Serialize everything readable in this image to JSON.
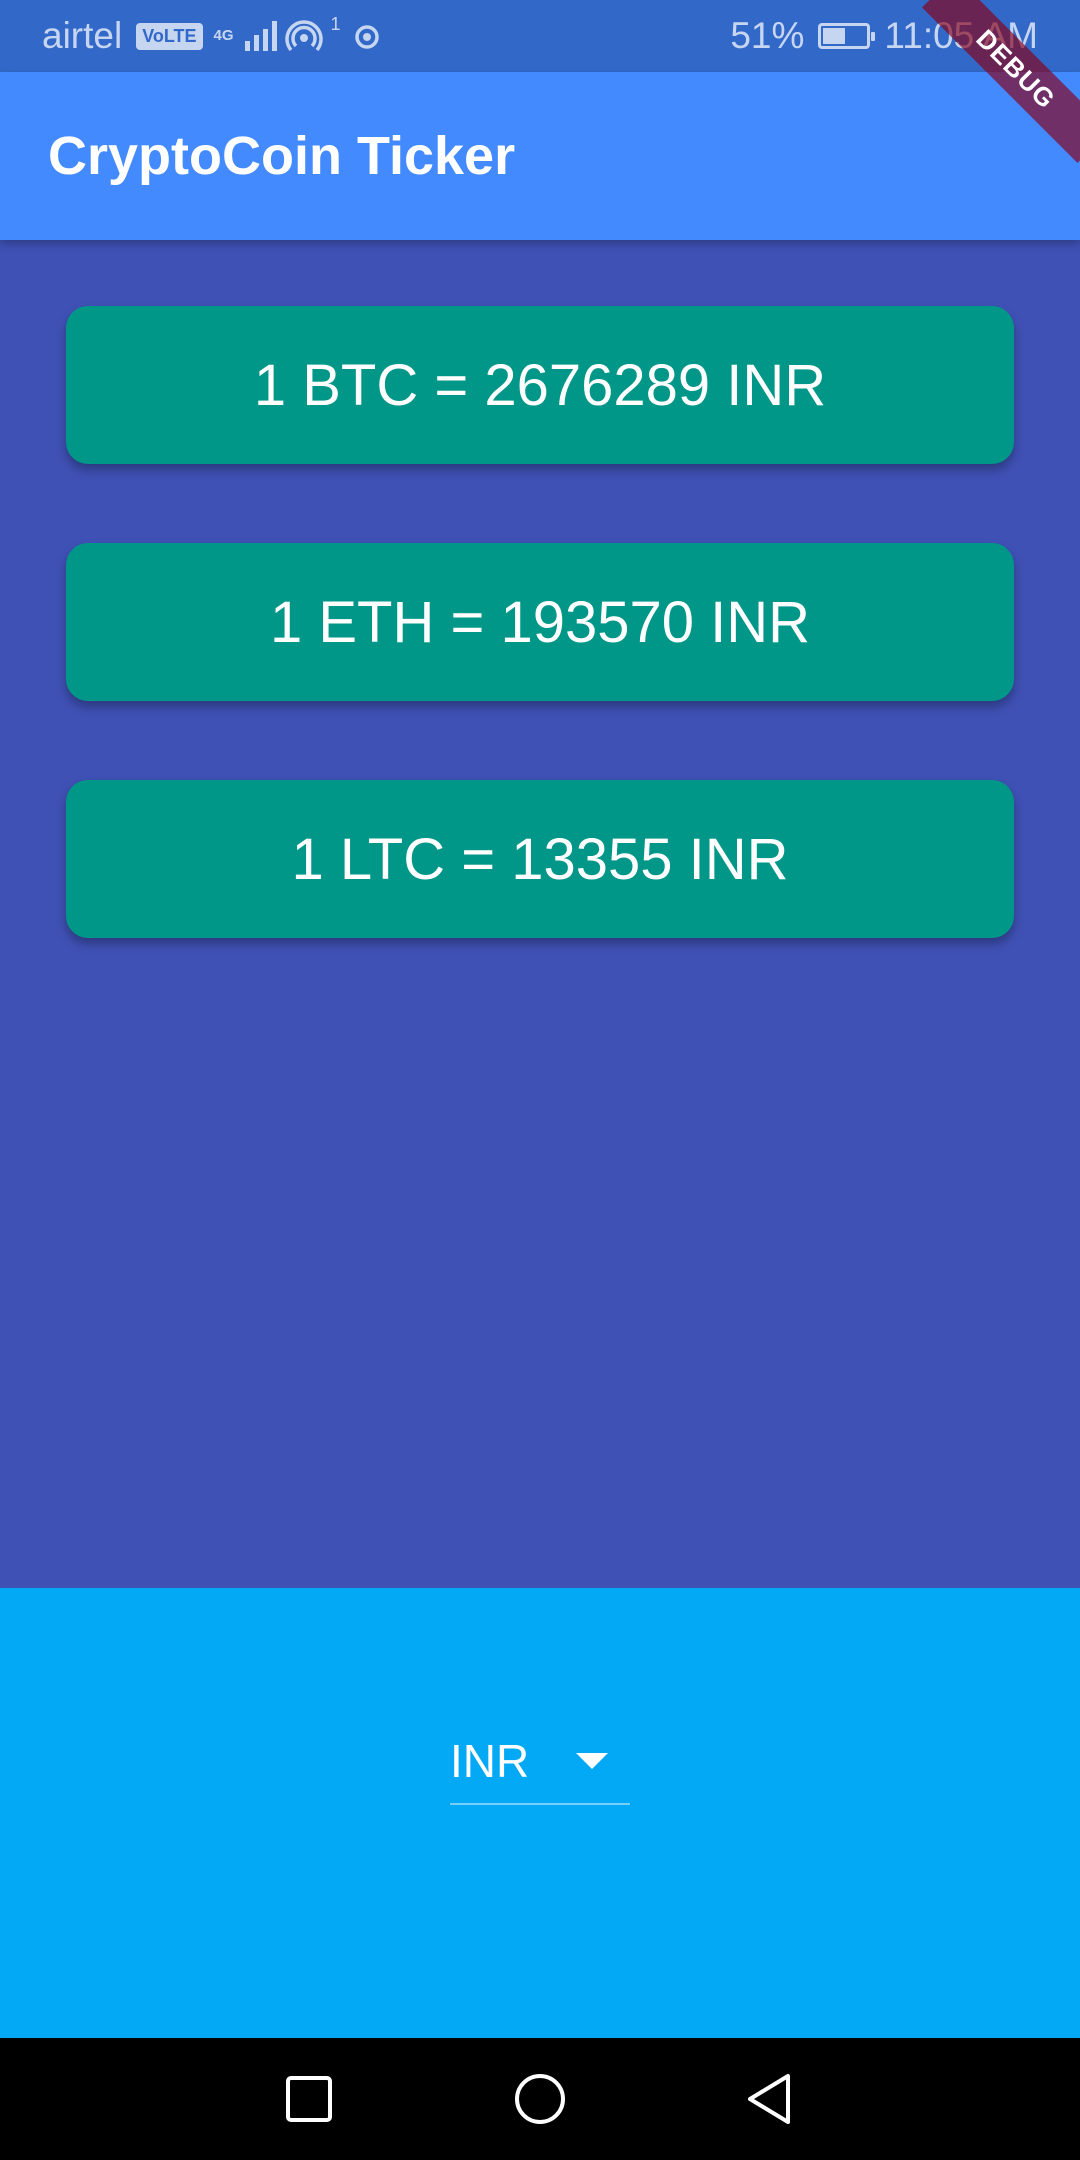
{
  "status_bar": {
    "carrier": "airtel",
    "volte": "VoLTE",
    "network": "4G",
    "hotspot_count": "1",
    "battery_percent": "51%",
    "battery_level": 0.51,
    "time": "11:05 AM"
  },
  "debug_banner": "DEBUG",
  "app_bar": {
    "title": "CryptoCoin Ticker"
  },
  "rates": [
    {
      "text": "1 BTC = 2676289 INR"
    },
    {
      "text": "1 ETH = 193570 INR"
    },
    {
      "text": "1 LTC = 13355 INR"
    }
  ],
  "currency_picker": {
    "selected": "INR"
  },
  "nav_bar": {
    "icons": [
      "recents-square-icon",
      "home-circle-icon",
      "back-triangle-icon"
    ]
  },
  "colors": {
    "status_bar": "#3269c9",
    "app_bar": "#448aff",
    "background": "#3f51b5",
    "card": "#009688",
    "picker_area": "#03a9f4",
    "nav_bar": "#000000"
  }
}
